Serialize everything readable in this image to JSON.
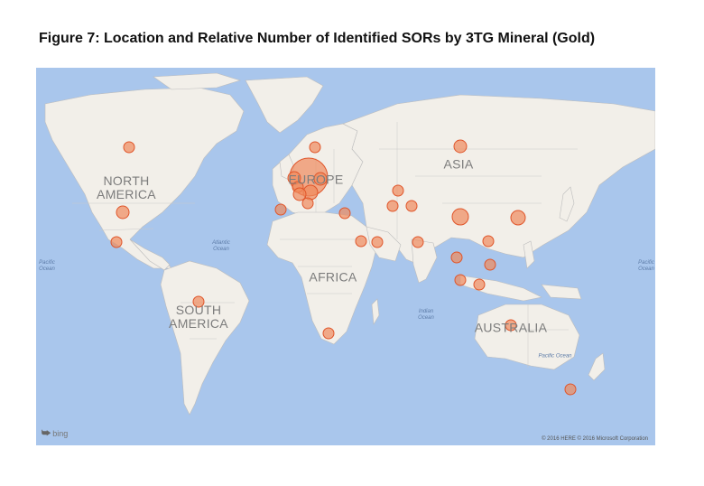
{
  "figure": {
    "title": "Figure 7: Location and Relative Number of Identified SORs by 3TG Mineral (Gold)"
  },
  "map": {
    "continents": [
      {
        "id": "north-america",
        "label": "NORTH\nAMERICA"
      },
      {
        "id": "south-america",
        "label": "SOUTH\nAMERICA"
      },
      {
        "id": "europe",
        "label": "EUROPE"
      },
      {
        "id": "africa",
        "label": "AFRICA"
      },
      {
        "id": "asia",
        "label": "ASIA"
      },
      {
        "id": "australia",
        "label": "AUSTRALIA"
      }
    ],
    "oceans": [
      {
        "id": "pacific-left",
        "label": "Pacific\nOcean"
      },
      {
        "id": "atlantic",
        "label": "Atlantic\nOcean"
      },
      {
        "id": "indian",
        "label": "Indian\nOcean"
      },
      {
        "id": "pacific-right",
        "label": "Pacific\nOcean"
      },
      {
        "id": "pacific-south",
        "label": "Pacific Ocean"
      }
    ],
    "brand": "bing",
    "attribution": "© 2016 HERE   © 2016 Microsoft Corporation",
    "colors": {
      "water": "#a9c6ec",
      "land": "#f2efe9",
      "border": "#bdbdbd",
      "marker_fill": "#f08a5d",
      "marker_stroke": "#e0552a"
    }
  }
}
